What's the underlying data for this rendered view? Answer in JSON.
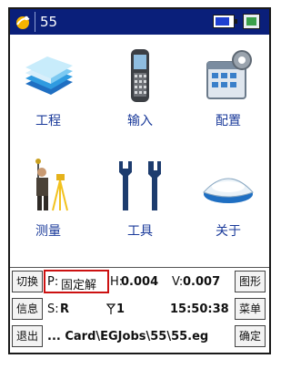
{
  "titlebar": {
    "title": "55",
    "logo_icon": "satellite-logo-icon",
    "battery_icon": "battery-icon",
    "keyboard_icon": "keyboard-icon"
  },
  "apps": [
    {
      "label": "工程",
      "icon": "project-books-icon"
    },
    {
      "label": "输入",
      "icon": "handheld-device-icon"
    },
    {
      "label": "配置",
      "icon": "settings-calendar-gear-icon"
    },
    {
      "label": "测量",
      "icon": "surveyor-icon"
    },
    {
      "label": "工具",
      "icon": "wrench-tools-icon"
    },
    {
      "label": "关于",
      "icon": "gnss-receiver-icon"
    }
  ],
  "status": {
    "left_buttons": [
      "切换",
      "信息",
      "退出"
    ],
    "right_buttons": [
      "图形",
      "菜单",
      "确定"
    ],
    "p_label": "P:",
    "p_value": "固定解",
    "h_label": "H:",
    "h_value": "0.004",
    "v_label": "V:",
    "v_value": "0.007",
    "s_label": "S:",
    "s_value": "R",
    "sat_value": "1",
    "time": "15:50:38",
    "path": "... Card\\EGJobs\\55\\55.eg"
  },
  "colors": {
    "titlebar": "#0a1f7a",
    "label": "#1a3a9a",
    "highlight": "#cc1111"
  }
}
